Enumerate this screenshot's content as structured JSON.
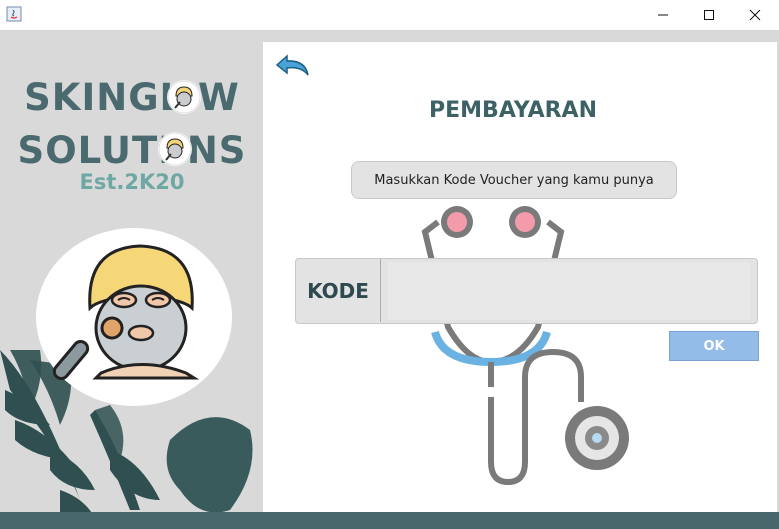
{
  "window": {
    "title": "",
    "controls": [
      "minimize",
      "maximize",
      "close"
    ]
  },
  "brand": {
    "line1": "SKINGL  W",
    "line2": "SOLUTI  NS",
    "tagline": "Est.2K20"
  },
  "page": {
    "title": "PEMBAYARAN",
    "voucher_button_label": "Masukkan Kode Voucher yang kamu punya",
    "code_label": "KODE",
    "code_value": "",
    "ok_label": "OK"
  },
  "colors": {
    "brand": "#4a6a70",
    "tagline": "#6fa7a4",
    "ok_button": "#94bce8",
    "bottom_bar": "#47676c",
    "back_arrow": "#4aa3d6"
  },
  "icons": [
    "app-java-icon",
    "back-arrow-icon",
    "minimize-icon",
    "maximize-icon",
    "close-icon",
    "face-mask-icon",
    "stethoscope-icon",
    "leaf-decoration"
  ]
}
